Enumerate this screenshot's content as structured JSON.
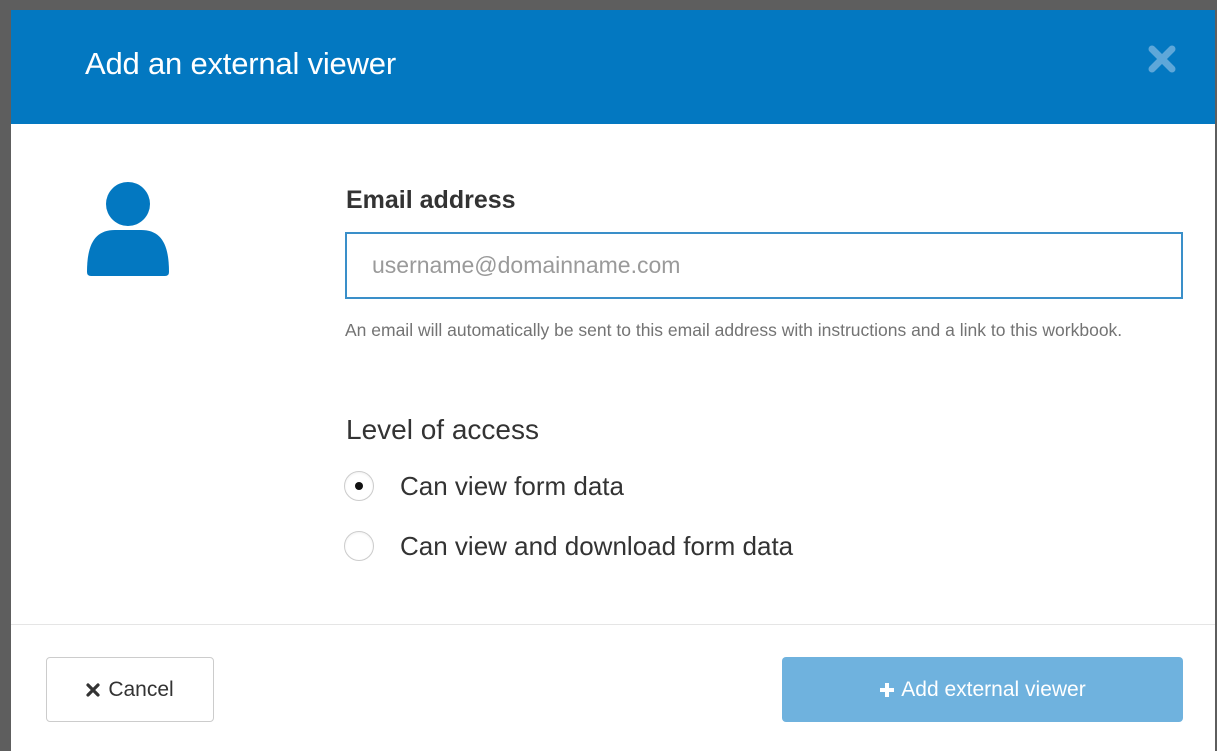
{
  "dialog": {
    "title": "Add an external viewer",
    "close_icon": "close-icon",
    "avatar_icon": "user-icon"
  },
  "email": {
    "label": "Email address",
    "value": "",
    "placeholder": "username@domainname.com",
    "help": "An email will automatically be sent to this email address with instructions and a link to this workbook."
  },
  "access": {
    "label": "Level of access",
    "options": [
      {
        "label": "Can view form data",
        "selected": true
      },
      {
        "label": "Can view and download form data",
        "selected": false
      }
    ]
  },
  "footer": {
    "cancel_label": "Cancel",
    "cancel_icon": "times-icon",
    "add_label": "Add external viewer",
    "add_icon": "plus-icon"
  },
  "colors": {
    "header": "#0378c1",
    "primary_button": "#6fb2de",
    "avatar": "#0378c1",
    "input_border": "#3a8fc9"
  }
}
